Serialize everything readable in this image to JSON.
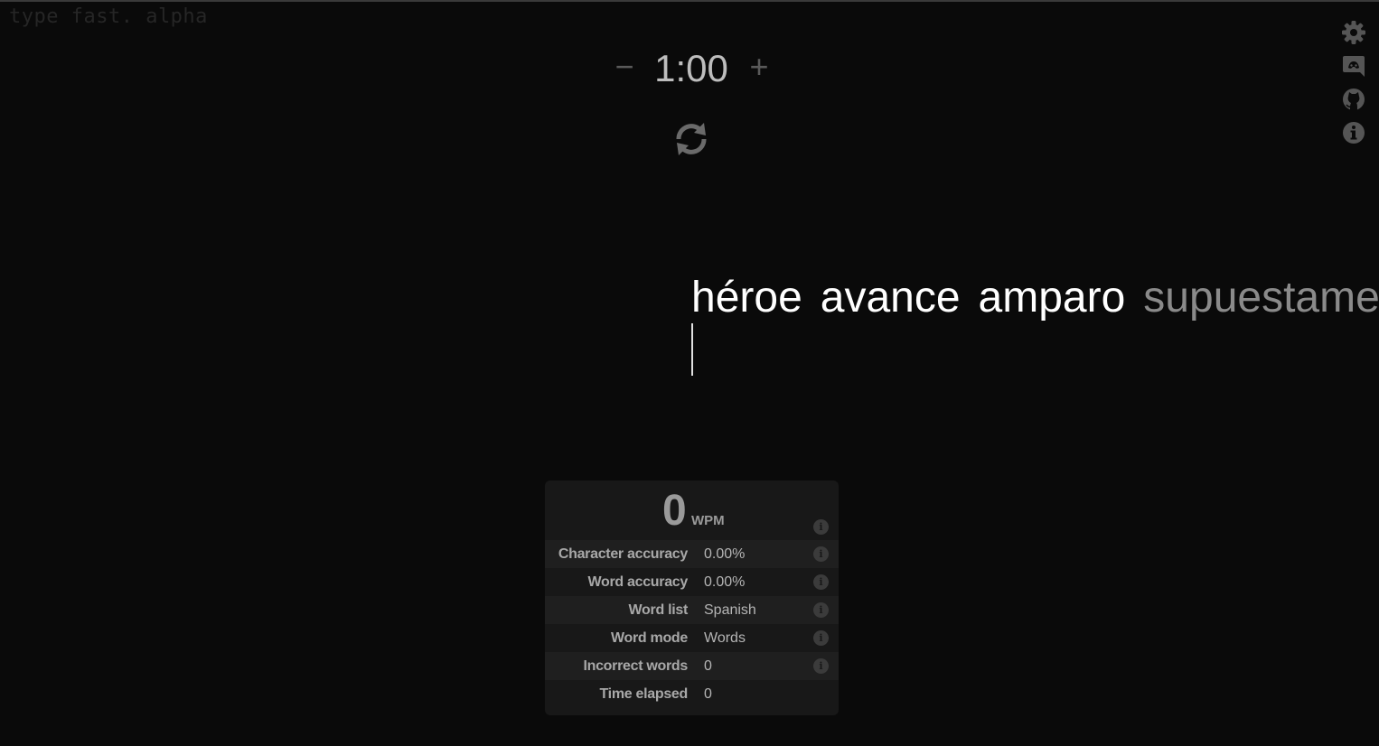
{
  "brand": "type fast. alpha",
  "timer": {
    "minus_label": "−",
    "value": "1:00",
    "plus_label": "+"
  },
  "icons": {
    "restart": "refresh-icon",
    "side": [
      "gear-icon",
      "discord-icon",
      "github-icon",
      "info-icon"
    ]
  },
  "words": [
    {
      "text": "héroe",
      "state": "current"
    },
    {
      "text": "avance",
      "state": "upcoming"
    },
    {
      "text": "amparo",
      "state": "upcoming"
    },
    {
      "text": "supuestame",
      "state": "fading"
    }
  ],
  "stats": {
    "wpm": {
      "value": "0",
      "unit": "WPM"
    },
    "rows": [
      {
        "label": "Character accuracy",
        "value": "0.00%"
      },
      {
        "label": "Word accuracy",
        "value": "0.00%"
      },
      {
        "label": "Word list",
        "value": "Spanish"
      },
      {
        "label": "Word mode",
        "value": "Words"
      },
      {
        "label": "Incorrect words",
        "value": "0"
      },
      {
        "label": "Time elapsed",
        "value": "0"
      }
    ],
    "info_glyph": "i"
  },
  "colors": {
    "background": "#0a0a0a",
    "text_active": "#ffffff",
    "text_muted": "#5a5a5a"
  }
}
